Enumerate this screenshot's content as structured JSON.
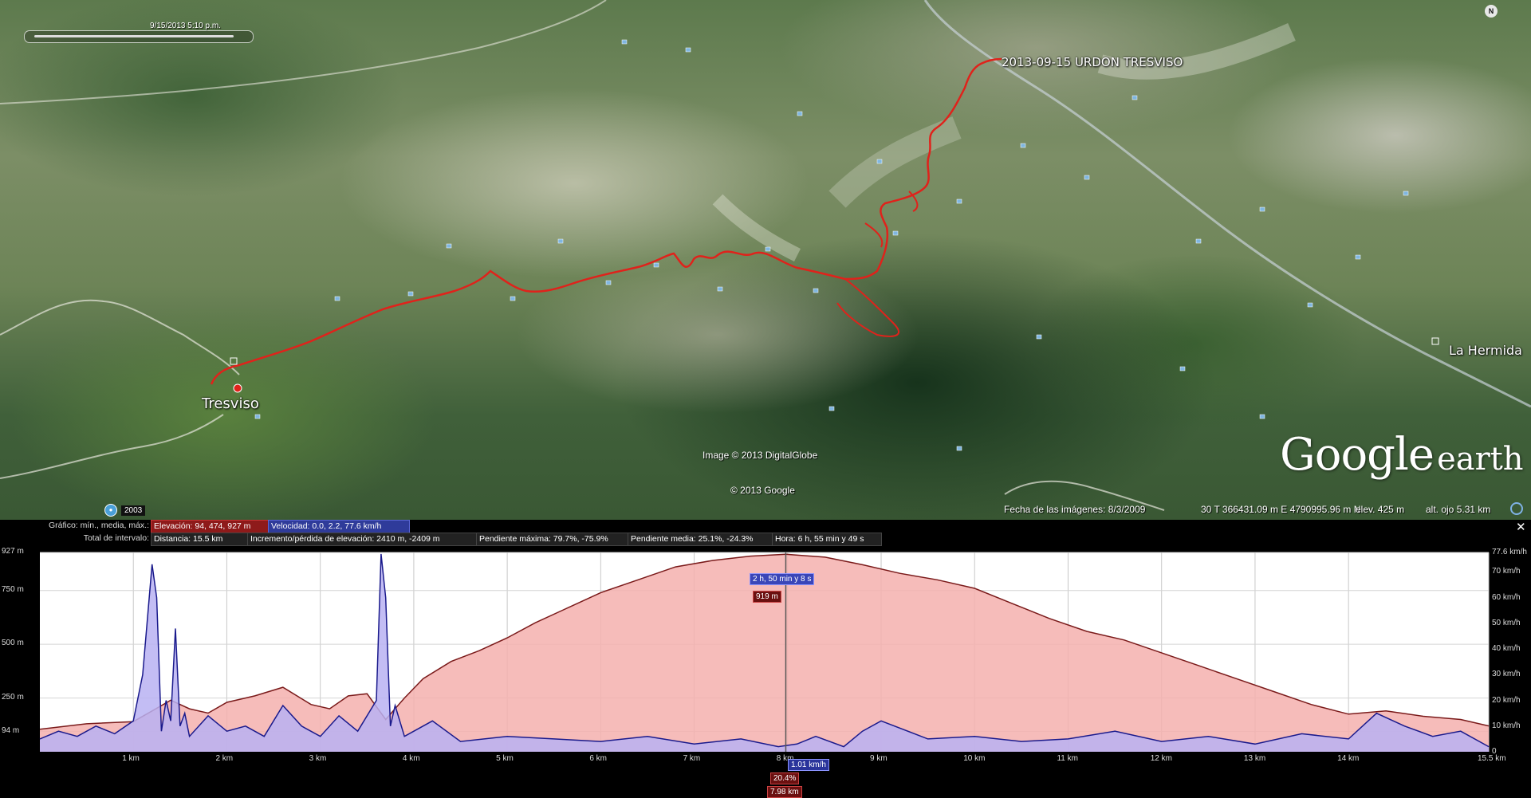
{
  "map": {
    "time_text": "9/15/2013   5:10 p.m.",
    "track_label": "2013-09-15 URDON TRESVISO",
    "places": {
      "tresviso": "Tresviso",
      "la_hermida": "La Hermida"
    },
    "image_copyright": "Image © 2013 DigitalGlobe",
    "google_copyright": "© 2013 Google",
    "logo_google": "Google",
    "logo_earth": "earth",
    "compass": "N",
    "imagery_year": "2003",
    "track_color": "#e0221b"
  },
  "status": {
    "imagery_date": "Fecha de las imágenes: 8/3/2009",
    "coords": "30 T 366431.09 m E 4790995.96 m N",
    "elevation": "elev.   425 m",
    "eye_alt": "alt. ojo   5.31 km"
  },
  "profile": {
    "close": "✕",
    "graph_label": "Gráfico: mín., media, máx.:",
    "elevation_chip": "Elevación:  94, 474, 927 m",
    "speed_chip": "Velocidad:  0.0, 2.2, 77.6 km/h",
    "range_label": "Total de intervalo:",
    "distance": "Distancia:  15.5 km",
    "gain_loss": "Incremento/pérdida de elevación:  2410 m, -2409 m",
    "max_grade": "Pendiente máxima:  79.7%, -75.9%",
    "avg_grade": "Pendiente media:  25.1%, -24.3%",
    "time": "Hora:  6 h, 55 min y 49 s",
    "marker_time": "2 h, 50 min y 8 s",
    "marker_elev": "919 m",
    "marker_speed": "1.01 km/h",
    "marker_grade": "20.4%",
    "marker_dist": "7.98 km"
  },
  "chart_data": {
    "type": "area",
    "x_unit": "km",
    "xlim": [
      0,
      15.5
    ],
    "x_ticks": [
      "1 km",
      "2 km",
      "3 km",
      "4 km",
      "5 km",
      "6 km",
      "7 km",
      "8 km",
      "9 km",
      "10 km",
      "11 km",
      "12 km",
      "13 km",
      "14 km",
      "15.5 km"
    ],
    "left_axis": {
      "unit": "m",
      "ticks": [
        "927 m",
        "750 m",
        "500 m",
        "250 m",
        "94 m"
      ],
      "values": [
        927,
        750,
        500,
        250,
        94
      ],
      "range": [
        0,
        927
      ]
    },
    "right_axis": {
      "unit": "km/h",
      "ticks": [
        "77.6 km/h",
        "70 km/h",
        "60 km/h",
        "50 km/h",
        "40 km/h",
        "30 km/h",
        "20 km/h",
        "10 km/h",
        "0"
      ],
      "values": [
        77.6,
        70,
        60,
        50,
        40,
        30,
        20,
        10,
        0
      ],
      "range": [
        0,
        77.6
      ]
    },
    "series": [
      {
        "name": "Elevación",
        "color": "#7a1a1a",
        "fill": "#f4b0ae",
        "x": [
          0,
          0.5,
          1.0,
          1.2,
          1.4,
          1.6,
          1.8,
          2.0,
          2.3,
          2.6,
          2.9,
          3.1,
          3.3,
          3.5,
          3.7,
          3.9,
          4.1,
          4.4,
          4.7,
          5.0,
          5.3,
          5.6,
          6.0,
          6.4,
          6.8,
          7.2,
          7.6,
          7.98,
          8.4,
          8.8,
          9.2,
          9.6,
          10.0,
          10.4,
          10.8,
          11.2,
          11.6,
          12.0,
          12.4,
          12.8,
          13.2,
          13.6,
          14.0,
          14.4,
          14.8,
          15.2,
          15.5
        ],
        "y": [
          105,
          130,
          140,
          190,
          240,
          200,
          180,
          230,
          260,
          300,
          220,
          200,
          260,
          270,
          150,
          250,
          340,
          420,
          470,
          530,
          600,
          660,
          740,
          800,
          860,
          890,
          910,
          919,
          905,
          870,
          830,
          800,
          760,
          690,
          620,
          560,
          520,
          460,
          400,
          340,
          280,
          220,
          175,
          190,
          165,
          150,
          120
        ]
      },
      {
        "name": "Velocidad",
        "color": "#1a1a8c",
        "fill": "#b9b1f2",
        "x": [
          0,
          0.2,
          0.4,
          0.6,
          0.8,
          1.0,
          1.1,
          1.2,
          1.25,
          1.3,
          1.35,
          1.4,
          1.45,
          1.5,
          1.55,
          1.6,
          1.8,
          2.0,
          2.2,
          2.4,
          2.6,
          2.8,
          3.0,
          3.2,
          3.4,
          3.6,
          3.65,
          3.7,
          3.75,
          3.8,
          3.9,
          4.2,
          4.5,
          5.0,
          5.5,
          6.0,
          6.5,
          7.0,
          7.5,
          7.9,
          8.1,
          8.3,
          8.6,
          8.8,
          9.0,
          9.5,
          10.0,
          10.5,
          11.0,
          11.5,
          12.0,
          12.5,
          13.0,
          13.5,
          14.0,
          14.3,
          14.6,
          14.9,
          15.2,
          15.5
        ],
        "y": [
          5,
          8,
          6,
          10,
          7,
          12,
          30,
          73,
          60,
          8,
          20,
          12,
          48,
          10,
          15,
          6,
          14,
          8,
          10,
          6,
          18,
          10,
          6,
          14,
          8,
          20,
          77,
          60,
          10,
          18,
          6,
          12,
          4,
          6,
          5,
          4,
          6,
          3,
          5,
          2,
          3,
          6,
          2,
          8,
          12,
          5,
          6,
          4,
          5,
          8,
          4,
          6,
          3,
          7,
          5,
          15,
          10,
          6,
          8,
          2
        ]
      }
    ],
    "marker": {
      "distance_km": 7.98,
      "elevation_m": 919,
      "speed_kmh": 1.01,
      "grade_pct": 20.4,
      "time": "2 h, 50 min y 8 s"
    }
  }
}
